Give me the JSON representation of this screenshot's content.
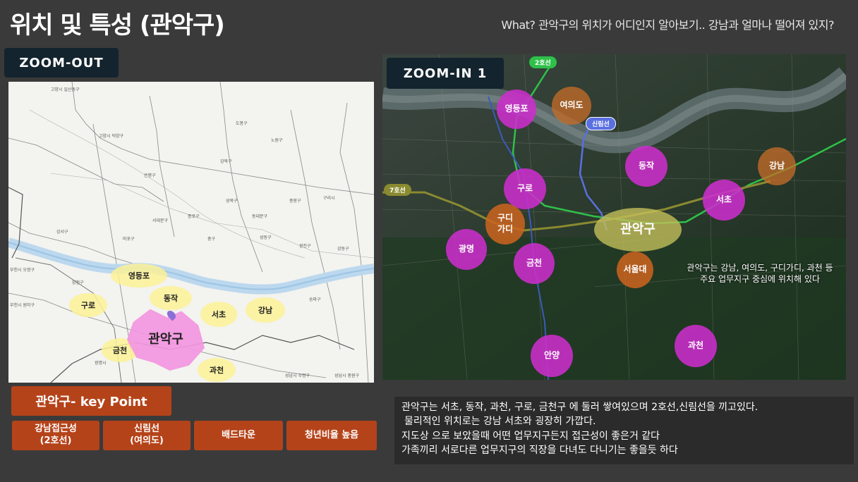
{
  "header": {
    "title": "위치 및 특성 (관악구)",
    "subtitle": "What? 관악구의 위치가 어디인지 알아보기.. 강남과 얼마나 떨어져 있지?"
  },
  "zoom_out": {
    "label": "ZOOM-OUT",
    "small_labels": [
      "고양시 일산동구",
      "고양시 덕양구",
      "도봉구",
      "노원구",
      "강북구",
      "은평구",
      "성북구",
      "중랑구",
      "종로구",
      "동대문구",
      "서대문구",
      "마포구",
      "중구",
      "성동구",
      "광진구",
      "강동구",
      "송파구",
      "구리시",
      "강서구",
      "양천구",
      "부천시 오정구",
      "부천시 원미구",
      "광명시",
      "성남시 수정구",
      "성남시 중원구"
    ],
    "highlights": {
      "yeongdeungpo": "영등포",
      "dongjak": "동작",
      "guro": "구로",
      "seocho": "서초",
      "gangnam": "강남",
      "geumcheon": "금천",
      "gwacheon": "과천",
      "gwanak": "관악구"
    }
  },
  "zoom_in": {
    "label": "ZOOM-IN 1",
    "line2": "2호선",
    "sillim_line": "신림선",
    "line7": "7호선",
    "yeongdeungpo": "영등포",
    "yeouido": "여의도",
    "dongjak": "동작",
    "gangnam": "강남",
    "guro": "구로",
    "seocho": "서초",
    "gurodigital": "구디\n가디",
    "gwanak": "관악구",
    "gwangmyeong": "광명",
    "geumcheon": "금천",
    "snu": "서울대",
    "gwacheon": "과천",
    "anyang": "안양",
    "note_line1": "관악구는 강남, 여의도, 구디가디, 과천 등",
    "note_line2": "주요 업무지구 중심에 위치해 있다"
  },
  "key_point": {
    "title": "관악구- key Point",
    "items": [
      "강남접근성\n(2호선)",
      "신림선\n(여의도)",
      "배드타운",
      "청년비율 높음"
    ]
  },
  "summary": {
    "lines": [
      "관악구는 서초, 동작, 과천, 구로, 금천구 에 둘러 쌓여있으며 2호선,신림선을 끼고있다.",
      "물리적인 위치로는 강남 서초와 굉장히 가깝다.",
      "지도상 으로 보았을때 어떤 업무지구든지 접근성이 좋은거 같다",
      "가족끼리 서로다른 업무지구의 직장을 다녀도 다니기는 좋을듯 하다"
    ]
  },
  "colors": {
    "background": "#3a3a3a",
    "zoom_label_bg": "#14242e",
    "key_point_bg": "#b5431a",
    "purple": "#cc2ecc",
    "orange": "#cc641e"
  }
}
